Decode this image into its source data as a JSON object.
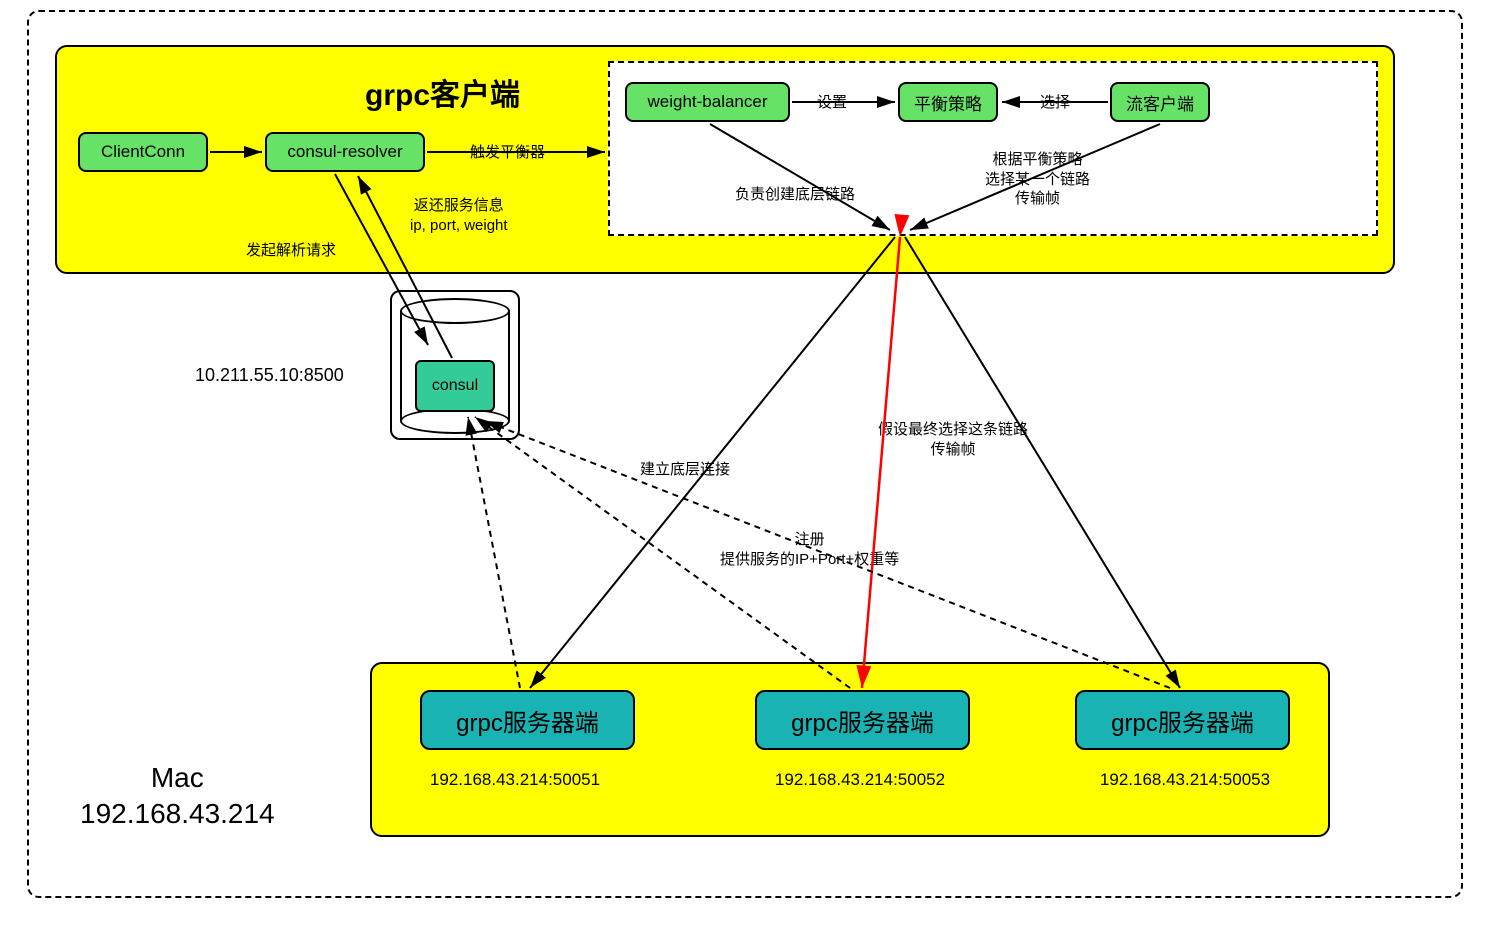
{
  "outer": {
    "mac_label": "Mac\n192.168.43.214"
  },
  "client": {
    "title": "grpc客户端"
  },
  "nodes": {
    "clientconn": "ClientConn",
    "resolver": "consul-resolver",
    "weight_balancer": "weight-balancer",
    "policy": "平衡策略",
    "stream": "流客户端",
    "consul": "consul"
  },
  "consul_addr": "10.211.55.10:8500",
  "servers": {
    "label": "grpc服务器端",
    "addr1": "192.168.43.214:50051",
    "addr2": "192.168.43.214:50052",
    "addr3": "192.168.43.214:50053"
  },
  "edges": {
    "trigger_balancer": "触发平衡器",
    "set": "设置",
    "select": "选择",
    "return_info": "返还服务信息\nip, port, weight",
    "send_resolve": "发起解析请求",
    "create_link": "负责创建底层链路",
    "pick_link": "根据平衡策略\n选择某一个链路\n传输帧",
    "assume_select": "假设最终选择这条链路\n传输帧",
    "build_conn": "建立底层连接",
    "register": "注册\n提供服务的IP+Port+权重等"
  }
}
